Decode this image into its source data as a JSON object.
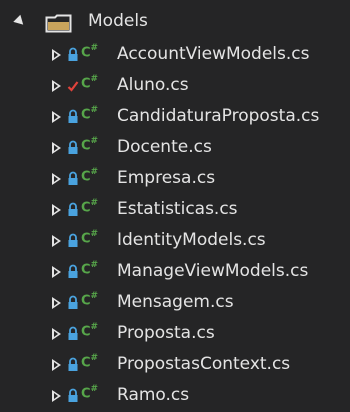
{
  "folder": {
    "name": "Models",
    "icon": "folder-icon",
    "expanded": true
  },
  "files": [
    {
      "name": "AccountViewModels.cs",
      "state": "lock"
    },
    {
      "name": "Aluno.cs",
      "state": "checkmark"
    },
    {
      "name": "CandidaturaProposta.cs",
      "state": "lock"
    },
    {
      "name": "Docente.cs",
      "state": "lock"
    },
    {
      "name": "Empresa.cs",
      "state": "lock"
    },
    {
      "name": "Estatisticas.cs",
      "state": "lock"
    },
    {
      "name": "IdentityModels.cs",
      "state": "lock"
    },
    {
      "name": "ManageViewModels.cs",
      "state": "lock"
    },
    {
      "name": "Mensagem.cs",
      "state": "lock"
    },
    {
      "name": "Proposta.cs",
      "state": "lock"
    },
    {
      "name": "PropostasContext.cs",
      "state": "lock"
    },
    {
      "name": "Ramo.cs",
      "state": "lock"
    }
  ],
  "colors": {
    "background": "#252526",
    "text": "#e4e4e4",
    "lock": "#4aa3df",
    "checkmark": "#e0433b",
    "csharp": "#57a64a"
  }
}
